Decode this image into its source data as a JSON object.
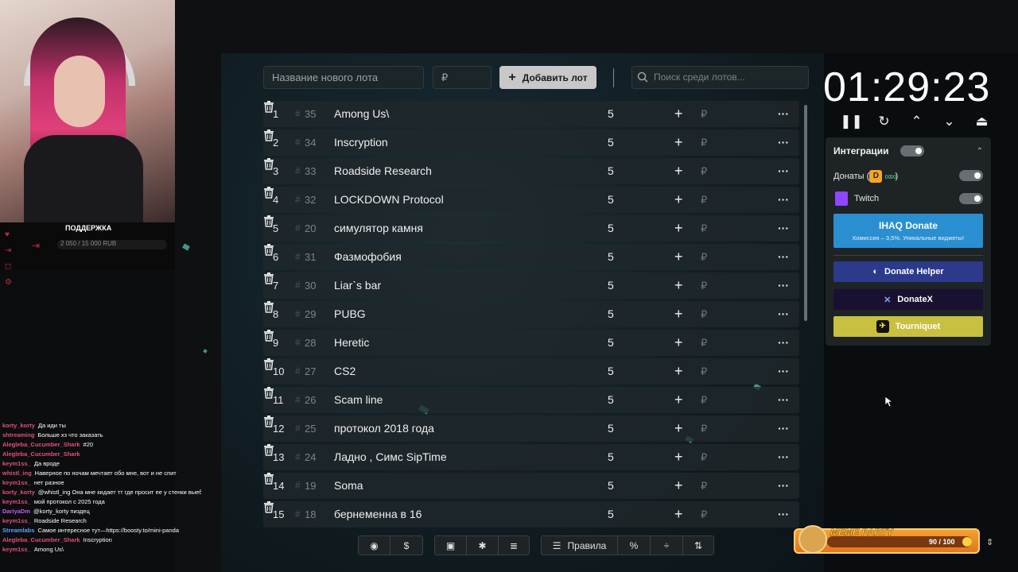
{
  "stream": {
    "support_title": "ПОДДЕРЖКА",
    "support_amount": "2 050 / 15 000 RUB",
    "chat": [
      {
        "user": "korty_korty",
        "text": "Да иди ты"
      },
      {
        "user": "shtreaming",
        "text": "Больше хз что заказать"
      },
      {
        "user": "Alegleba_Cucumber_Shark",
        "text": "#20"
      },
      {
        "user": "Alegleba_Cucumber_Shark",
        "text": ""
      },
      {
        "user": "keym1ss_",
        "text": "Да вроде"
      },
      {
        "user": "whistl_ing",
        "text": "Наверное по ночам мечтает обо мне, вот и не спит"
      },
      {
        "user": "keym1ss_",
        "text": "нет разное"
      },
      {
        "user": "korty_korty",
        "text": "@whistl_ing Она мне кидает тт где просит ее у стенки выебать..."
      },
      {
        "user": "keym1ss_",
        "text": "мой протокол с 2025 года"
      },
      {
        "user": "DariyaDm",
        "text": "@korty_korty пиздец"
      },
      {
        "user": "keym1ss_",
        "text": "Roadside Research"
      },
      {
        "user": "Streamlabs",
        "text": "Самое интересное тут—https://boosty.to/mini-panda"
      },
      {
        "user": "Alegleba_Cucumber_Shark",
        "text": "Inscryption"
      },
      {
        "user": "keym1ss_",
        "text": "Among Us\\"
      }
    ]
  },
  "top": {
    "lot_placeholder": "Название нового лота",
    "price_placeholder": "₽",
    "add_label": "Добавить лот",
    "search_placeholder": "Поиск среди лотов..."
  },
  "lots": [
    {
      "n": "1",
      "id": "35",
      "name": "Among Us\\",
      "amount": "5"
    },
    {
      "n": "2",
      "id": "34",
      "name": "Inscryption",
      "amount": "5"
    },
    {
      "n": "3",
      "id": "33",
      "name": "Roadside Research",
      "amount": "5"
    },
    {
      "n": "4",
      "id": "32",
      "name": "LOCKDOWN Protocol",
      "amount": "5"
    },
    {
      "n": "5",
      "id": "20",
      "name": "симулятор камня",
      "amount": "5"
    },
    {
      "n": "6",
      "id": "31",
      "name": "Фазмофобия",
      "amount": "5"
    },
    {
      "n": "7",
      "id": "30",
      "name": "Liar`s bar",
      "amount": "5"
    },
    {
      "n": "8",
      "id": "29",
      "name": "PUBG",
      "amount": "5"
    },
    {
      "n": "9",
      "id": "28",
      "name": "Heretic",
      "amount": "5"
    },
    {
      "n": "10",
      "id": "27",
      "name": "CS2",
      "amount": "5"
    },
    {
      "n": "11",
      "id": "26",
      "name": "Scam line",
      "amount": "5"
    },
    {
      "n": "12",
      "id": "25",
      "name": "протокол 2018 года",
      "amount": "5"
    },
    {
      "n": "13",
      "id": "24",
      "name": "Ладно , Симс SipTime",
      "amount": "5"
    },
    {
      "n": "14",
      "id": "19",
      "name": "Soma",
      "amount": "5"
    },
    {
      "n": "15",
      "id": "18",
      "name": "бернеменна в 16",
      "amount": "5"
    }
  ],
  "row_symbols": {
    "hash": "#",
    "plus": "+",
    "rub": "₽",
    "more": "···"
  },
  "bottom": {
    "rules_label": "Правила",
    "percent": "%"
  },
  "timer": {
    "value": "01:29:23"
  },
  "integrations": {
    "title": "Интеграции",
    "donations_label": "Донаты (",
    "donations_close": ")",
    "twitch_label": "Twitch",
    "ihaq_title": "IHAQ Donate",
    "ihaq_sub": "Комиссия – 3,5%. Уникальные виджеты!",
    "donate_helper": "Donate Helper",
    "donatex": "DonateX",
    "tourniquet": "Tourniquet",
    "colors": {
      "ihaq": "#2a8fd0",
      "helper": "#2b3a8a",
      "donatex": "#1a1030",
      "tourniquet": "#c8c040"
    }
  },
  "meme_party": {
    "title": "MEME PARTY",
    "value": "90 / 100"
  }
}
